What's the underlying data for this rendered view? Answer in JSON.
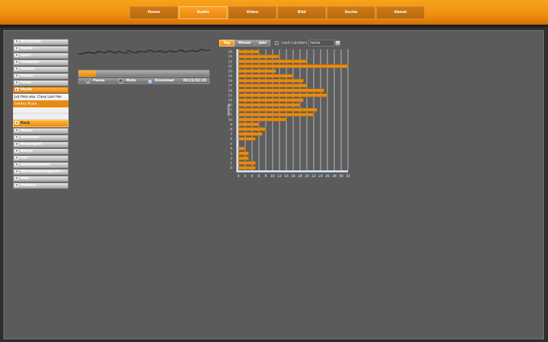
{
  "nav": [
    "Home",
    "Audio",
    "Video",
    "Bild",
    "Suche",
    "About"
  ],
  "nav_active": 1,
  "sidebar": {
    "top": [
      "Wirtschaft",
      "Politik",
      "Sport",
      "Computer",
      "Freizeit",
      "Reisen",
      "Filme"
    ],
    "active": "Musik",
    "songs": [
      "Juli Holz aka. Clara Lost Her",
      "Gallery Music"
    ],
    "genre": "Rock",
    "bottom": [
      "House",
      "Volleyball",
      "Motorsport",
      "Rallye",
      "Fun",
      "Netzneutralität",
      "Vorratsdatenspeiche...",
      "Müll",
      "Podcast"
    ]
  },
  "player": {
    "progress": 0.13,
    "pause": "Pause",
    "mute": "Mute",
    "download": "Download",
    "time": "00:21/02:28"
  },
  "filters": {
    "tabs": [
      "Tag",
      "Monat",
      "Jahr"
    ],
    "active_tab": 0,
    "country_label": "nach Ländern",
    "country_checked": false,
    "date_value": "heute"
  },
  "colors": {
    "accent": "#f29412",
    "bar": "#e88a10",
    "panel": "#5b5b5b"
  },
  "chart_data": {
    "type": "bar",
    "orientation": "horizontal",
    "ylabel": "Stunde",
    "categories": [
      "0",
      "1",
      "2",
      "3",
      "4",
      "5",
      "6",
      "7",
      "8",
      "9",
      "10",
      "11",
      "12",
      "13",
      "14",
      "15",
      "16",
      "17",
      "18",
      "19",
      "20",
      "21",
      "22",
      "23",
      "24"
    ],
    "values": [
      5,
      5,
      3,
      3,
      2,
      0,
      5,
      7,
      8,
      6,
      14,
      22,
      23,
      18,
      19,
      26,
      25,
      20,
      19,
      16,
      11,
      32,
      20,
      12,
      6
    ],
    "xticks": [
      "0",
      "2",
      "4",
      "6",
      "8",
      "10",
      "12",
      "14",
      "16",
      "18",
      "20",
      "22",
      "24",
      "26",
      "28",
      "30",
      "32"
    ],
    "xlim": [
      0,
      32
    ],
    "grid": "vertical"
  }
}
